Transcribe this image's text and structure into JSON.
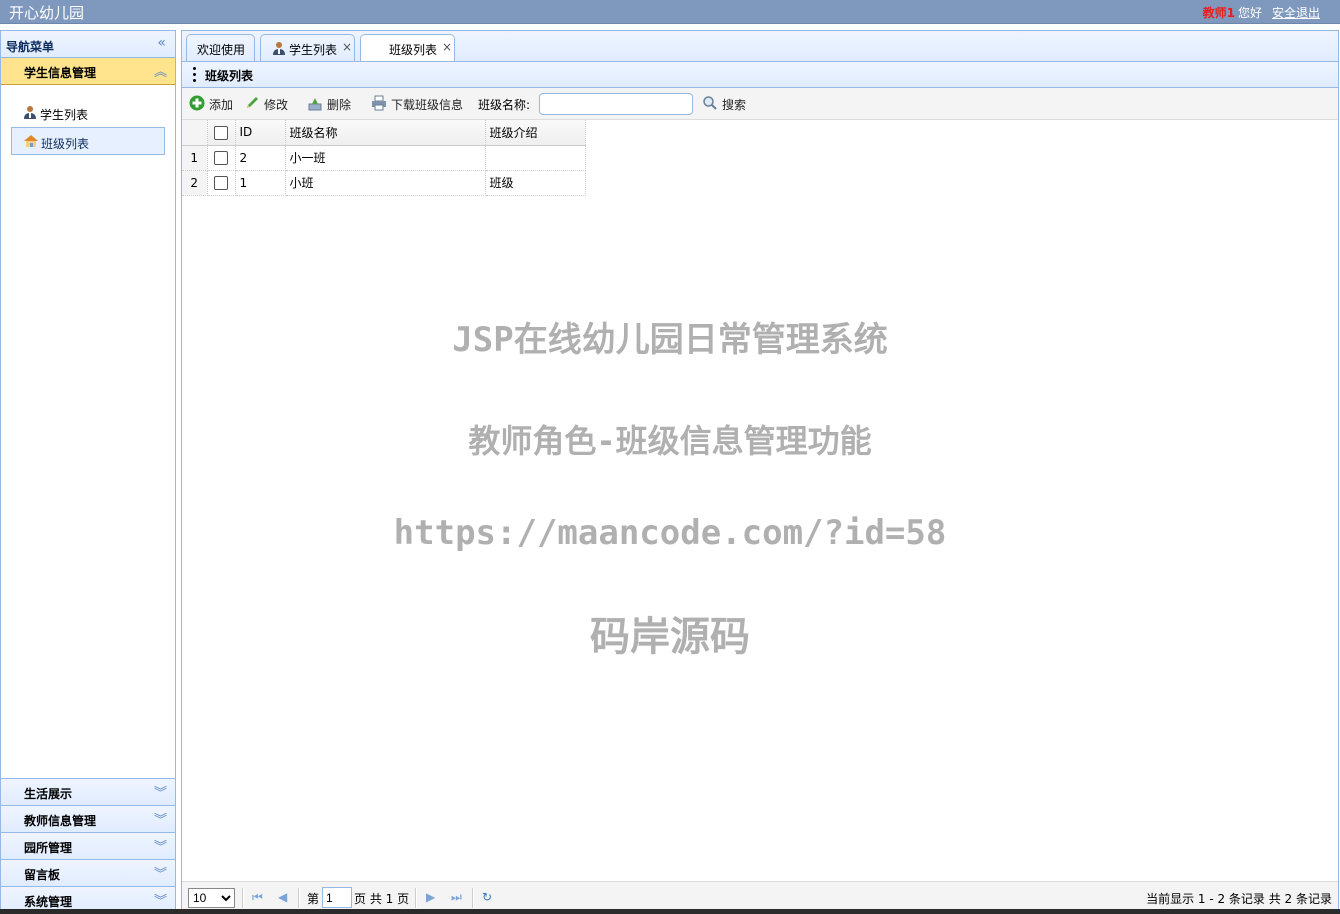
{
  "header": {
    "app_title": "开心幼儿园",
    "user_role": "教师1",
    "greeting": "您好",
    "logout": "安全退出"
  },
  "nav": {
    "title": "导航菜单",
    "active_section": "学生信息管理",
    "items": [
      {
        "label": "学生列表",
        "icon": "student-icon"
      },
      {
        "label": "班级列表",
        "icon": "house-icon",
        "selected": true
      }
    ],
    "sections": [
      "生活展示",
      "教师信息管理",
      "园所管理",
      "留言板",
      "系统管理"
    ]
  },
  "tabs": [
    {
      "label": "欢迎使用"
    },
    {
      "label": "学生列表",
      "close": "×"
    },
    {
      "label": "班级列表",
      "close": "×",
      "active": true
    }
  ],
  "panel": {
    "title": "班级列表"
  },
  "toolbar": {
    "add": "添加",
    "edit": "修改",
    "delete": "删除",
    "download": "下载班级信息",
    "search_label": "班级名称:",
    "search_value": "",
    "search_button": "搜索"
  },
  "grid": {
    "columns": [
      "ID",
      "班级名称",
      "班级介绍"
    ],
    "rows": [
      {
        "num": "1",
        "id": "2",
        "name": "小一班",
        "desc": ""
      },
      {
        "num": "2",
        "id": "1",
        "name": "小班",
        "desc": "班级"
      }
    ]
  },
  "watermark": {
    "line1": "JSP在线幼儿园日常管理系统",
    "line2": "教师角色-班级信息管理功能",
    "line3": "https://maancode.com/?id=58",
    "line4": "码岸源码"
  },
  "pager": {
    "page_size": "10",
    "page_prefix": "第",
    "page_value": "1",
    "page_suffix": "页 共 1 页",
    "info": "当前显示 1 - 2 条记录 共 2 条记录"
  },
  "colors": {
    "header_bg": "#7f99be",
    "accent_border": "#95b8e7",
    "active_section_bg": "#ffe48d",
    "user_red": "#e8201a"
  }
}
